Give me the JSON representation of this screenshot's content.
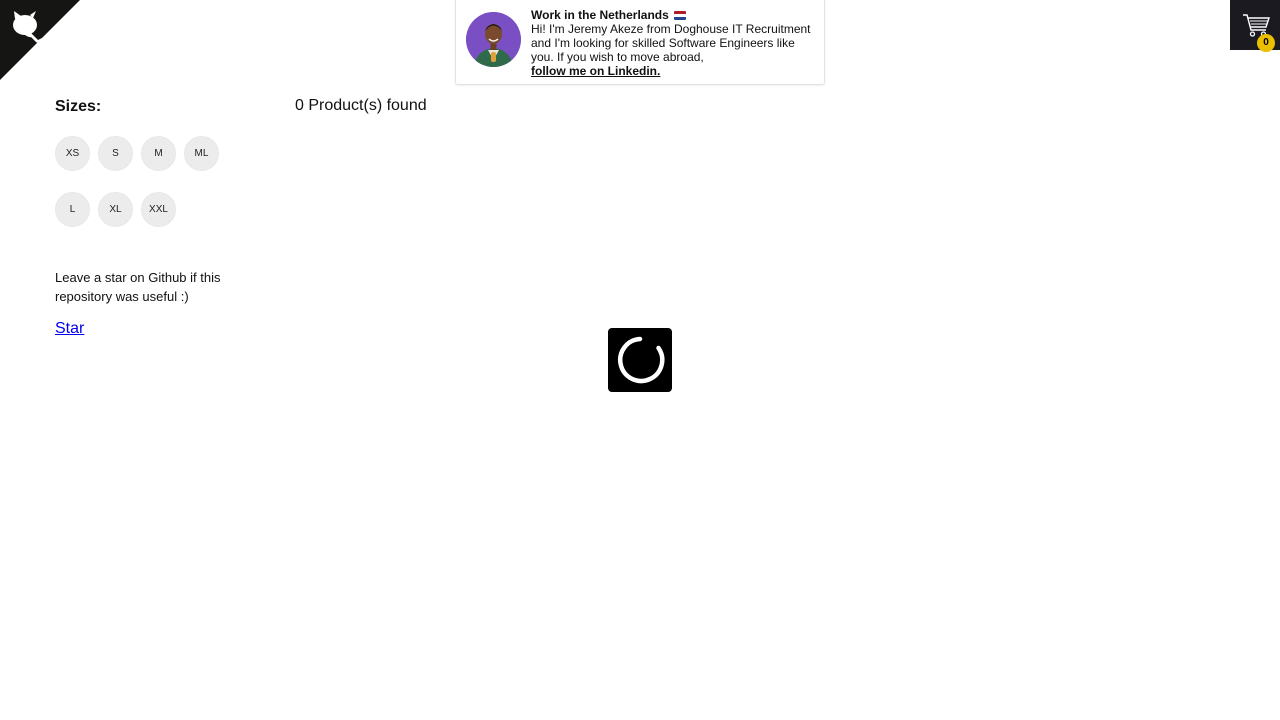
{
  "github_corner": {
    "icon": "octocat-icon",
    "color": "#151513"
  },
  "banner": {
    "title": "Work in the Netherlands",
    "flag_icon": "netherlands-flag-icon",
    "body": "Hi! I'm Jeremy Akeze from Doghouse IT Recruitment and I'm looking for skilled Software Engineers like you. If you wish to move abroad,",
    "link": "follow me on Linkedin."
  },
  "cart": {
    "icon": "cart-icon",
    "count": "0",
    "badge_color": "#eabf00"
  },
  "filters": {
    "title": "Sizes:",
    "sizes": [
      "XS",
      "S",
      "M",
      "ML",
      "L",
      "XL",
      "XXL"
    ]
  },
  "github_star": {
    "text": "Leave a star on Github if this repository was useful :)",
    "link": "Star"
  },
  "products": {
    "found_text": "0 Product(s) found"
  },
  "loader": {
    "icon": "spinner-icon"
  }
}
